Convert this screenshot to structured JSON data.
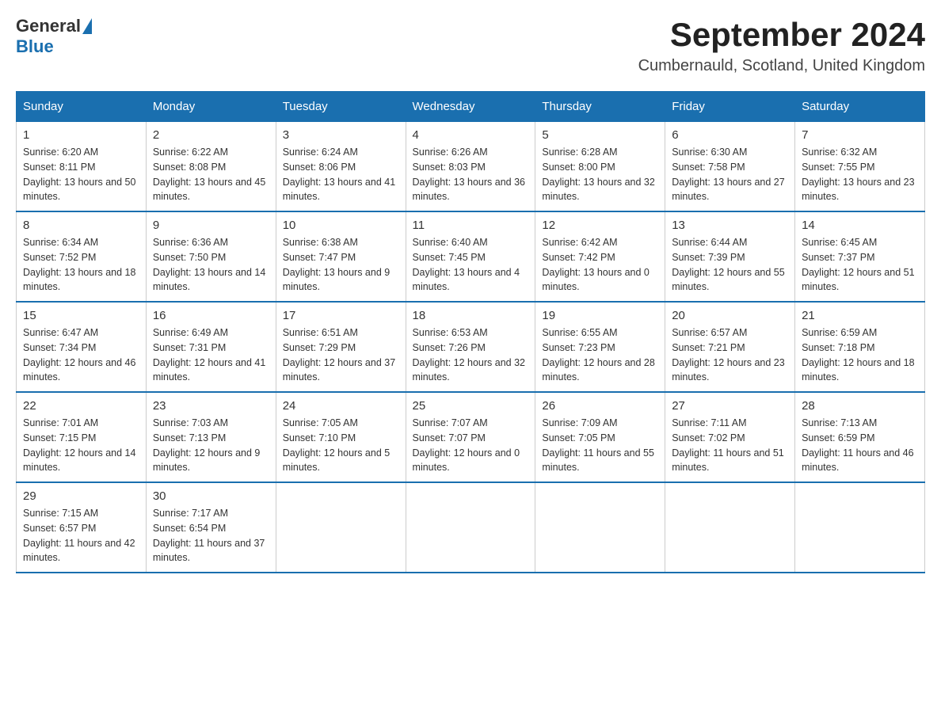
{
  "header": {
    "logo_general": "General",
    "logo_blue": "Blue",
    "month_year": "September 2024",
    "location": "Cumbernauld, Scotland, United Kingdom"
  },
  "days_of_week": [
    "Sunday",
    "Monday",
    "Tuesday",
    "Wednesday",
    "Thursday",
    "Friday",
    "Saturday"
  ],
  "weeks": [
    [
      {
        "day": "1",
        "sunrise": "6:20 AM",
        "sunset": "8:11 PM",
        "daylight": "13 hours and 50 minutes."
      },
      {
        "day": "2",
        "sunrise": "6:22 AM",
        "sunset": "8:08 PM",
        "daylight": "13 hours and 45 minutes."
      },
      {
        "day": "3",
        "sunrise": "6:24 AM",
        "sunset": "8:06 PM",
        "daylight": "13 hours and 41 minutes."
      },
      {
        "day": "4",
        "sunrise": "6:26 AM",
        "sunset": "8:03 PM",
        "daylight": "13 hours and 36 minutes."
      },
      {
        "day": "5",
        "sunrise": "6:28 AM",
        "sunset": "8:00 PM",
        "daylight": "13 hours and 32 minutes."
      },
      {
        "day": "6",
        "sunrise": "6:30 AM",
        "sunset": "7:58 PM",
        "daylight": "13 hours and 27 minutes."
      },
      {
        "day": "7",
        "sunrise": "6:32 AM",
        "sunset": "7:55 PM",
        "daylight": "13 hours and 23 minutes."
      }
    ],
    [
      {
        "day": "8",
        "sunrise": "6:34 AM",
        "sunset": "7:52 PM",
        "daylight": "13 hours and 18 minutes."
      },
      {
        "day": "9",
        "sunrise": "6:36 AM",
        "sunset": "7:50 PM",
        "daylight": "13 hours and 14 minutes."
      },
      {
        "day": "10",
        "sunrise": "6:38 AM",
        "sunset": "7:47 PM",
        "daylight": "13 hours and 9 minutes."
      },
      {
        "day": "11",
        "sunrise": "6:40 AM",
        "sunset": "7:45 PM",
        "daylight": "13 hours and 4 minutes."
      },
      {
        "day": "12",
        "sunrise": "6:42 AM",
        "sunset": "7:42 PM",
        "daylight": "13 hours and 0 minutes."
      },
      {
        "day": "13",
        "sunrise": "6:44 AM",
        "sunset": "7:39 PM",
        "daylight": "12 hours and 55 minutes."
      },
      {
        "day": "14",
        "sunrise": "6:45 AM",
        "sunset": "7:37 PM",
        "daylight": "12 hours and 51 minutes."
      }
    ],
    [
      {
        "day": "15",
        "sunrise": "6:47 AM",
        "sunset": "7:34 PM",
        "daylight": "12 hours and 46 minutes."
      },
      {
        "day": "16",
        "sunrise": "6:49 AM",
        "sunset": "7:31 PM",
        "daylight": "12 hours and 41 minutes."
      },
      {
        "day": "17",
        "sunrise": "6:51 AM",
        "sunset": "7:29 PM",
        "daylight": "12 hours and 37 minutes."
      },
      {
        "day": "18",
        "sunrise": "6:53 AM",
        "sunset": "7:26 PM",
        "daylight": "12 hours and 32 minutes."
      },
      {
        "day": "19",
        "sunrise": "6:55 AM",
        "sunset": "7:23 PM",
        "daylight": "12 hours and 28 minutes."
      },
      {
        "day": "20",
        "sunrise": "6:57 AM",
        "sunset": "7:21 PM",
        "daylight": "12 hours and 23 minutes."
      },
      {
        "day": "21",
        "sunrise": "6:59 AM",
        "sunset": "7:18 PM",
        "daylight": "12 hours and 18 minutes."
      }
    ],
    [
      {
        "day": "22",
        "sunrise": "7:01 AM",
        "sunset": "7:15 PM",
        "daylight": "12 hours and 14 minutes."
      },
      {
        "day": "23",
        "sunrise": "7:03 AM",
        "sunset": "7:13 PM",
        "daylight": "12 hours and 9 minutes."
      },
      {
        "day": "24",
        "sunrise": "7:05 AM",
        "sunset": "7:10 PM",
        "daylight": "12 hours and 5 minutes."
      },
      {
        "day": "25",
        "sunrise": "7:07 AM",
        "sunset": "7:07 PM",
        "daylight": "12 hours and 0 minutes."
      },
      {
        "day": "26",
        "sunrise": "7:09 AM",
        "sunset": "7:05 PM",
        "daylight": "11 hours and 55 minutes."
      },
      {
        "day": "27",
        "sunrise": "7:11 AM",
        "sunset": "7:02 PM",
        "daylight": "11 hours and 51 minutes."
      },
      {
        "day": "28",
        "sunrise": "7:13 AM",
        "sunset": "6:59 PM",
        "daylight": "11 hours and 46 minutes."
      }
    ],
    [
      {
        "day": "29",
        "sunrise": "7:15 AM",
        "sunset": "6:57 PM",
        "daylight": "11 hours and 42 minutes."
      },
      {
        "day": "30",
        "sunrise": "7:17 AM",
        "sunset": "6:54 PM",
        "daylight": "11 hours and 37 minutes."
      },
      null,
      null,
      null,
      null,
      null
    ]
  ]
}
